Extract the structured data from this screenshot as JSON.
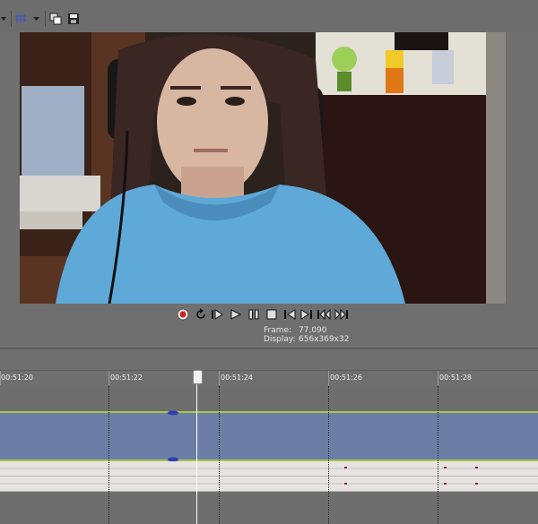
{
  "toolbar": {
    "icons": [
      "dropdown-arrow-icon",
      "grid-icon",
      "dropdown-arrow-icon",
      "copy-snapshot-icon",
      "save-snapshot-icon"
    ]
  },
  "transport": {
    "icons": [
      "record-icon",
      "loop-icon",
      "play-from-start-icon",
      "play-icon",
      "pause-icon",
      "stop-icon",
      "previous-frame-start-icon",
      "next-frame-end-icon",
      "previous-frame-icon",
      "next-frame-icon"
    ]
  },
  "info": {
    "frame_label": "Frame:",
    "frame_value": "77,090",
    "display_label": "Display:",
    "display_value": "656x369x32"
  },
  "ruler": {
    "labels": [
      "00:51:20",
      "00:51:22",
      "00:51:24",
      "00:51:26",
      "00:51:28"
    ]
  },
  "colors": {
    "video_track": "#6c7ea6",
    "track_border": "#a6c64a",
    "audio_track": "#e7e3e3",
    "record": "#d02020"
  }
}
